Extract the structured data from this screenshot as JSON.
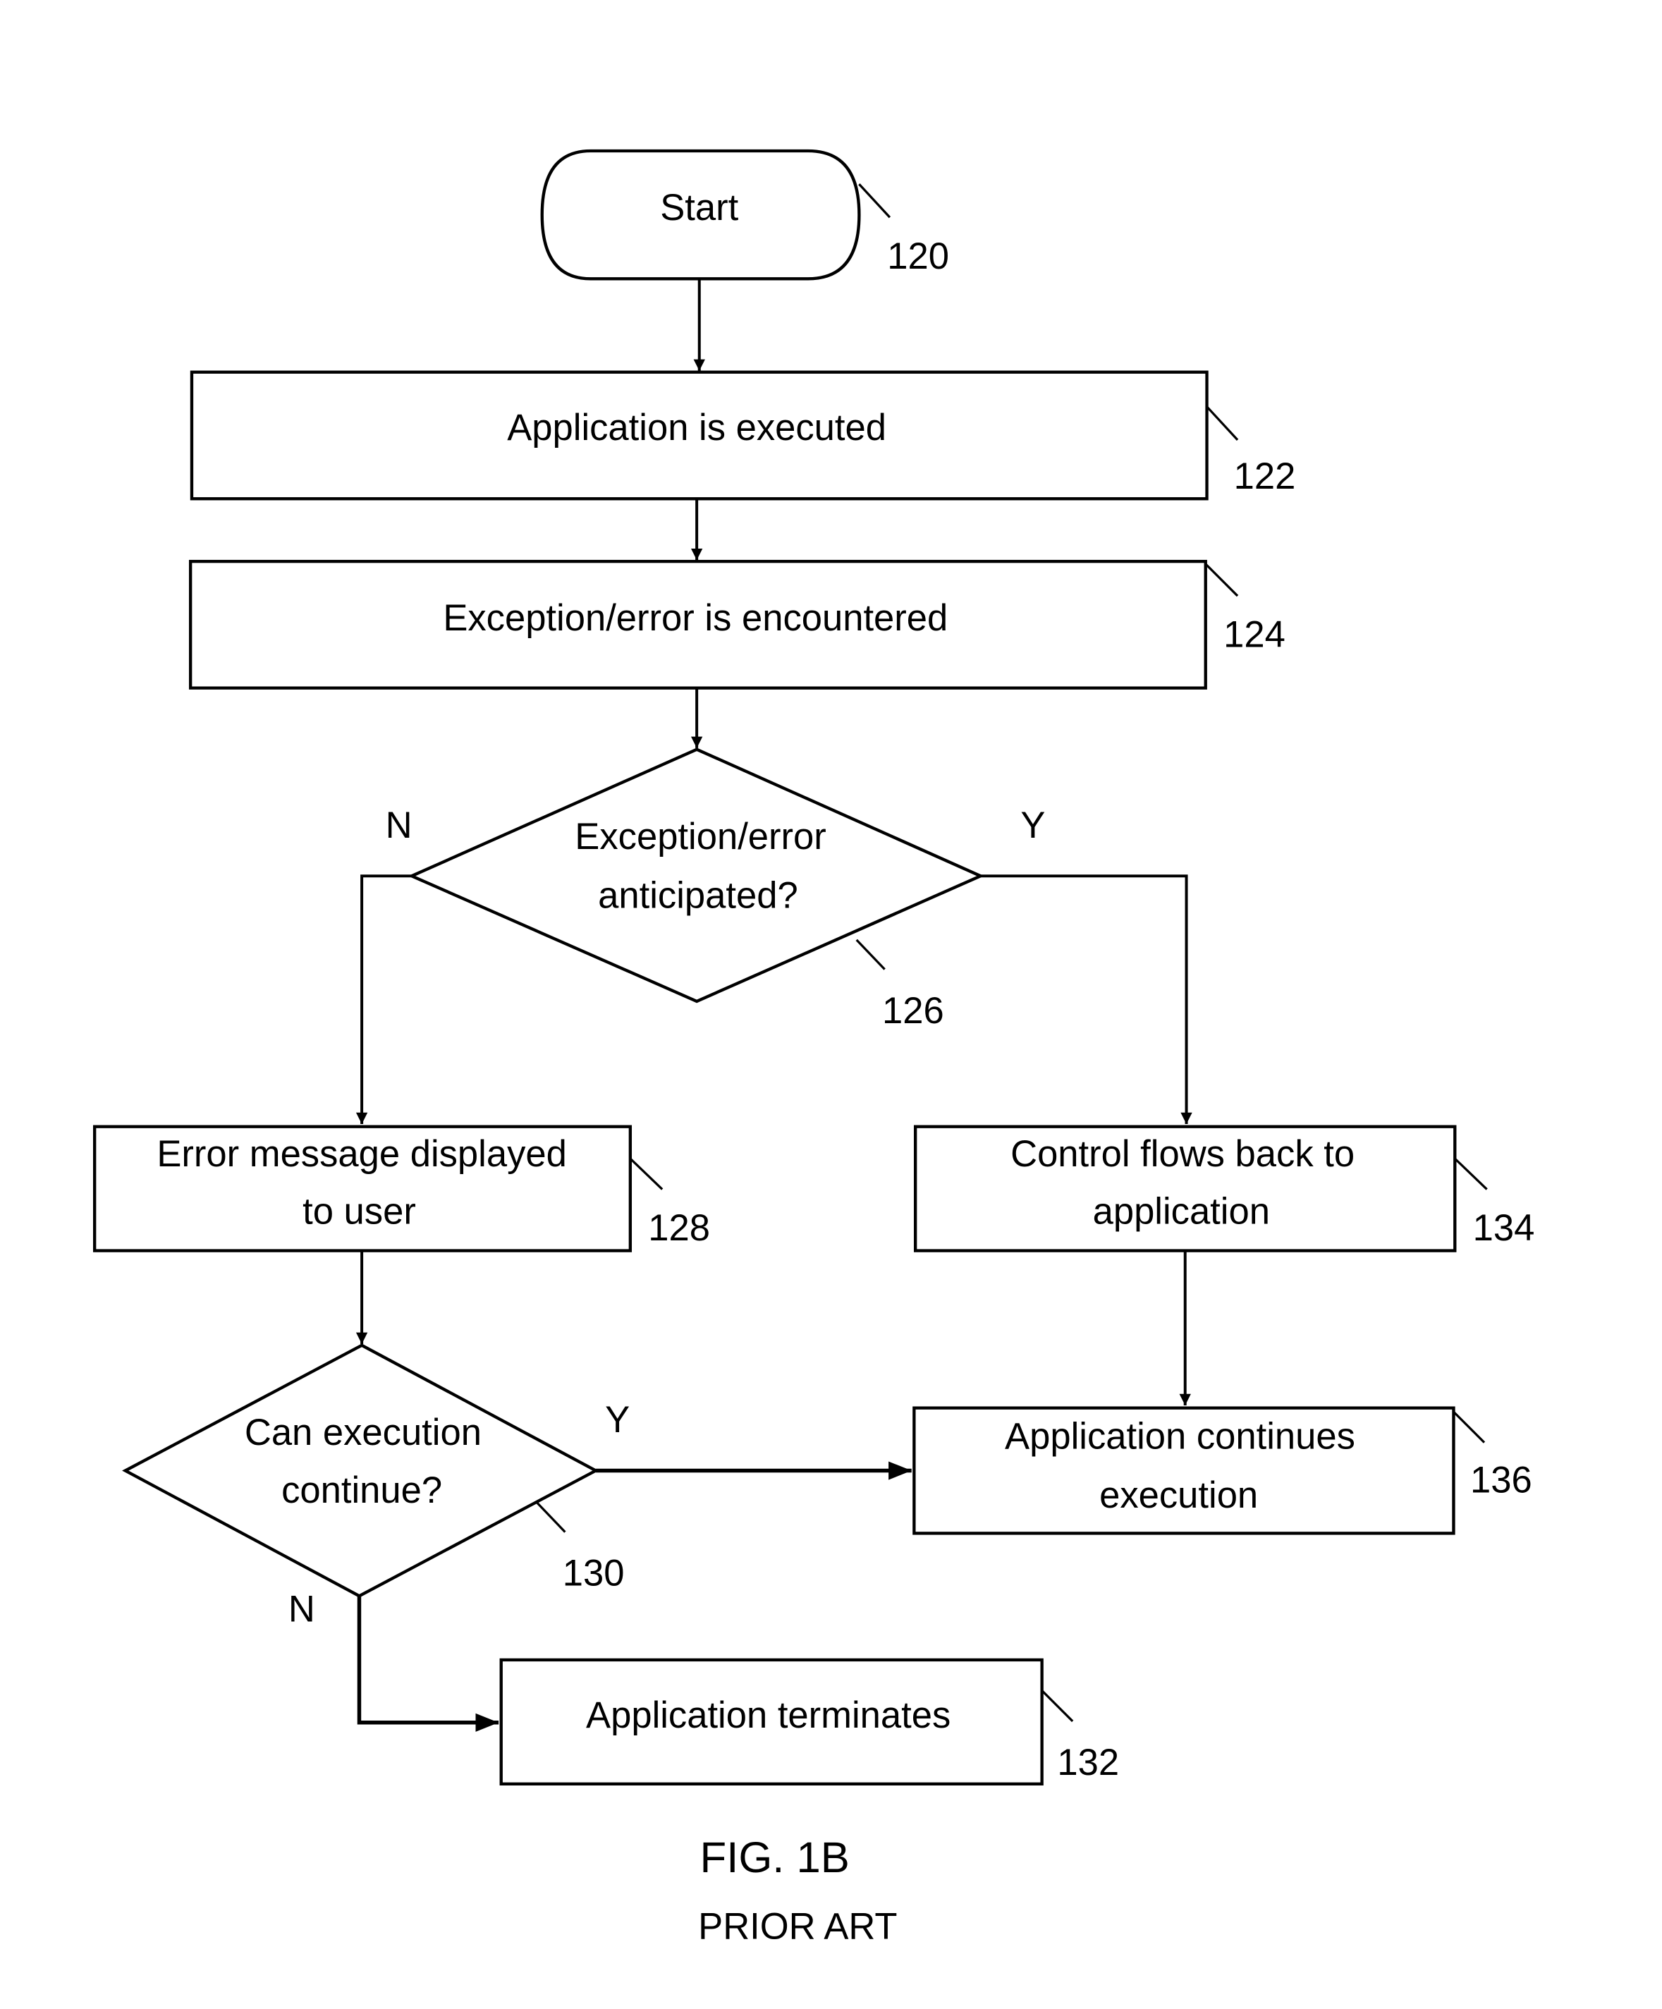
{
  "figure": {
    "caption": "FIG. 1B",
    "subcaption": "PRIOR ART"
  },
  "nodes": {
    "start": {
      "ref": "120",
      "lines": [
        "Start"
      ]
    },
    "app_executed": {
      "ref": "122",
      "lines": [
        "Application is executed"
      ]
    },
    "exception_encountered": {
      "ref": "124",
      "lines": [
        "Exception/error is encountered"
      ]
    },
    "anticipated_decision": {
      "ref": "126",
      "lines": [
        "Exception/error",
        "anticipated?"
      ]
    },
    "error_message": {
      "ref": "128",
      "lines": [
        "Error message displayed",
        "to user"
      ]
    },
    "continue_decision": {
      "ref": "130",
      "lines": [
        "Can execution",
        "continue?"
      ]
    },
    "app_terminates": {
      "ref": "132",
      "lines": [
        "Application terminates"
      ]
    },
    "control_back": {
      "ref": "134",
      "lines": [
        "Control flows back to",
        "application"
      ]
    },
    "app_continues": {
      "ref": "136",
      "lines": [
        "Application continues",
        "execution"
      ]
    }
  },
  "branches": {
    "anticipated_no": "N",
    "anticipated_yes": "Y",
    "continue_yes": "Y",
    "continue_no": "N"
  }
}
